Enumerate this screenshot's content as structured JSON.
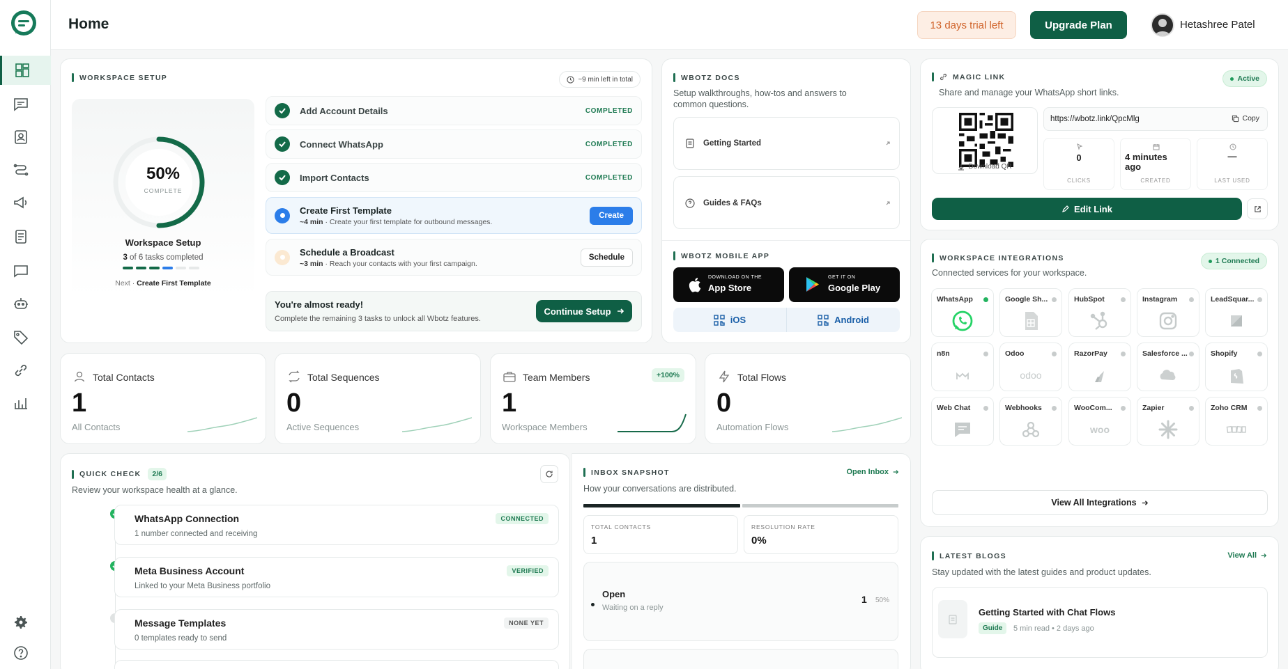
{
  "header": {
    "title": "Home",
    "trial": "13 days trial left",
    "upgrade": "Upgrade Plan",
    "user": "Hetashree Patel"
  },
  "setup": {
    "title": "WORKSPACE SETUP",
    "time_left": "~9 min left in total",
    "percent": "50%",
    "percent_value": 50,
    "complete": "COMPLETE",
    "label": "Workspace Setup",
    "tasks_done": "3",
    "tasks_rest": " of 6 tasks completed",
    "next_prefix": "Next · ",
    "next_task": "Create First Template",
    "tasks": [
      {
        "title": "Add Account Details",
        "status": "COMPLETED"
      },
      {
        "title": "Connect WhatsApp",
        "status": "COMPLETED"
      },
      {
        "title": "Import Contacts",
        "status": "COMPLETED"
      }
    ],
    "template": {
      "title": "Create First Template",
      "time": "~4 min",
      "desc": " · Create your first template for outbound messages.",
      "button": "Create"
    },
    "broadcast": {
      "title": "Schedule a Broadcast",
      "time": "~3 min",
      "desc": " · Reach your contacts with your first campaign.",
      "button": "Schedule"
    },
    "ready_title": "You're almost ready!",
    "ready_desc": "Complete the remaining 3 tasks to unlock all Wbotz features.",
    "continue": "Continue Setup"
  },
  "docs": {
    "title": "WBOTZ DOCS",
    "desc": "Setup walkthroughs, how-tos and answers to common questions.",
    "items": [
      "Getting Started",
      "Guides & FAQs"
    ]
  },
  "mobile": {
    "title": "WBOTZ MOBILE APP",
    "appstore_small": "DOWNLOAD ON THE",
    "appstore": "App Store",
    "gplay_small": "GET IT ON",
    "gplay": "Google Play",
    "ios": "iOS",
    "android": "Android"
  },
  "magic": {
    "title": "MAGIC LINK",
    "status": "Active",
    "desc": "Share and manage your WhatsApp short links.",
    "url": "https://wbotz.link/QpcMlg",
    "copy": "Copy",
    "download": "Download QR",
    "clicks": "0",
    "clicks_label": "CLICKS",
    "created": "4 minutes ago",
    "created_label": "CREATED",
    "last_used": "—",
    "last_used_label": "LAST USED",
    "edit": "Edit Link"
  },
  "integrations": {
    "title": "WORKSPACE INTEGRATIONS",
    "connected": "1 Connected",
    "desc": "Connected services for your workspace.",
    "items": [
      "WhatsApp",
      "Google Sh...",
      "HubSpot",
      "Instagram",
      "LeadSquar...",
      "n8n",
      "Odoo",
      "RazorPay",
      "Salesforce ...",
      "Shopify",
      "Web Chat",
      "Webhooks",
      "WooCom...",
      "Zapier",
      "Zoho CRM"
    ],
    "odoo_logo": "odoo",
    "woo_logo": "woo",
    "view_all": "View All Integrations"
  },
  "stats": [
    {
      "label": "Total Contacts",
      "value": "1",
      "caption": "All Contacts"
    },
    {
      "label": "Total Sequences",
      "value": "0",
      "caption": "Active Sequences"
    },
    {
      "label": "Team Members",
      "value": "1",
      "caption": "Workspace Members",
      "badge": "+100%"
    },
    {
      "label": "Total Flows",
      "value": "0",
      "caption": "Automation Flows"
    }
  ],
  "quick": {
    "title": "QUICK CHECK",
    "count": "2/6",
    "desc": "Review your workspace health at a glance.",
    "items": [
      {
        "title": "WhatsApp Connection",
        "desc": "1 number connected and receiving",
        "badge": "CONNECTED"
      },
      {
        "title": "Meta Business Account",
        "desc": "Linked to your Meta Business portfolio",
        "badge": "VERIFIED"
      },
      {
        "title": "Message Templates",
        "desc": "0 templates ready to send",
        "badge": "NONE YET"
      }
    ]
  },
  "inbox": {
    "title": "INBOX SNAPSHOT",
    "open_inbox": "Open Inbox",
    "desc": "How your conversations are distributed.",
    "total_label": "TOTAL CONTACTS",
    "total": "1",
    "rate_label": "RESOLUTION RATE",
    "rate": "0%",
    "open": "Open",
    "open_desc": "Waiting on a reply",
    "open_count": "1",
    "open_pct": "50%",
    "open_share": 0.5
  },
  "blogs": {
    "title": "LATEST BLOGS",
    "view_all": "View All",
    "post_title": "Getting Started with Chat Flows",
    "tag": "Guide",
    "meta": "5 min read • 2 days ago"
  },
  "colors": {
    "primary": "#0f5f45",
    "accent_green": "#1e7a52",
    "trial_bg": "#fdeee4",
    "trial_text": "#d0632a"
  }
}
